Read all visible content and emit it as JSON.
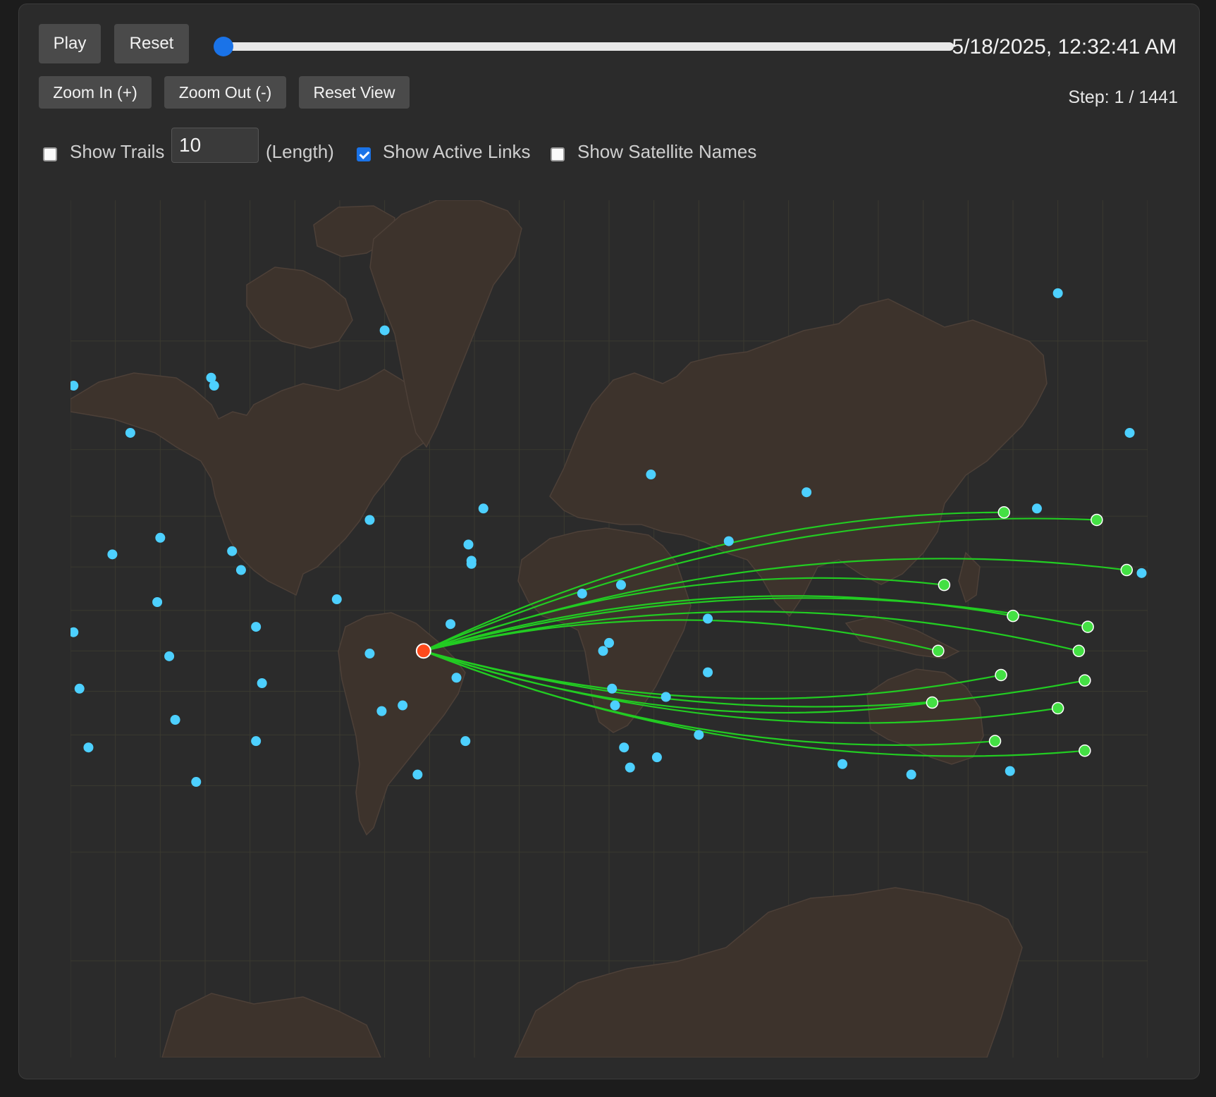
{
  "controls": {
    "play_label": "Play",
    "reset_label": "Reset",
    "zoom_in_label": "Zoom In (+)",
    "zoom_out_label": "Zoom Out (-)",
    "reset_view_label": "Reset View",
    "timeline_progress": 0,
    "datetime": "5/18/2025, 12:32:41 AM",
    "step_text": "Step: 1 / 1441"
  },
  "options": {
    "show_trails_label": "Show Trails",
    "show_trails_checked": false,
    "trail_length_value": "10",
    "trail_length_suffix": "(Length)",
    "show_active_links_label": "Show Active Links",
    "show_active_links_checked": true,
    "show_satellite_names_label": "Show Satellite Names",
    "show_satellite_names_checked": false
  },
  "colors": {
    "background": "#2b2b2b",
    "land": "#3d332c",
    "grid": "#3b3a30",
    "link": "#22cc22",
    "ground_station": "#ff4a1c",
    "linked_satellite": "#44e044",
    "satellite": "#4dd0ff",
    "slider_accent": "#1a73e8"
  },
  "map": {
    "lon_range": [
      -180,
      180
    ],
    "lat_range": [
      -82,
      84
    ],
    "ground_station": {
      "lon": -62.0,
      "lat": 0.0
    },
    "linked_satellites": [
      {
        "lon": 132.0,
        "lat": 46.0
      },
      {
        "lon": 112.0,
        "lat": 24.0
      },
      {
        "lon": 135.0,
        "lat": 13.0
      },
      {
        "lon": 163.0,
        "lat": 44.0
      },
      {
        "lon": 160.0,
        "lat": 9.0
      },
      {
        "lon": 110.0,
        "lat": 0.0
      },
      {
        "lon": 173.0,
        "lat": 29.0
      },
      {
        "lon": 157.0,
        "lat": 0.0
      },
      {
        "lon": 131.0,
        "lat": -9.0
      },
      {
        "lon": 108.0,
        "lat": -19.0
      },
      {
        "lon": 159.0,
        "lat": -11.0
      },
      {
        "lon": 150.0,
        "lat": -21.0
      },
      {
        "lon": 129.0,
        "lat": -32.0
      },
      {
        "lon": 159.0,
        "lat": -35.0
      }
    ],
    "satellites": [
      {
        "lon": -179,
        "lat": 70
      },
      {
        "lon": -160,
        "lat": 63
      },
      {
        "lon": -133,
        "lat": 71
      },
      {
        "lon": -132,
        "lat": 70
      },
      {
        "lon": -75,
        "lat": 76
      },
      {
        "lon": 150,
        "lat": 79
      },
      {
        "lon": 174,
        "lat": 63
      },
      {
        "lon": 14,
        "lat": 55
      },
      {
        "lon": 66,
        "lat": 51
      },
      {
        "lon": 143,
        "lat": 47
      },
      {
        "lon": -42,
        "lat": 47
      },
      {
        "lon": -80,
        "lat": 44
      },
      {
        "lon": -150,
        "lat": 39
      },
      {
        "lon": -166,
        "lat": 34
      },
      {
        "lon": -126,
        "lat": 35
      },
      {
        "lon": -123,
        "lat": 29
      },
      {
        "lon": -47,
        "lat": 37
      },
      {
        "lon": -46,
        "lat": 32
      },
      {
        "lon": -46,
        "lat": 31
      },
      {
        "lon": 178,
        "lat": 28
      },
      {
        "lon": 40,
        "lat": 38
      },
      {
        "lon": -9,
        "lat": 21
      },
      {
        "lon": 4,
        "lat": 24
      },
      {
        "lon": -91,
        "lat": 19
      },
      {
        "lon": -151,
        "lat": 18
      },
      {
        "lon": 33,
        "lat": 12
      },
      {
        "lon": -179,
        "lat": 7
      },
      {
        "lon": -118,
        "lat": 9
      },
      {
        "lon": -53,
        "lat": 10
      },
      {
        "lon": 0,
        "lat": 3
      },
      {
        "lon": -2,
        "lat": 0
      },
      {
        "lon": -80,
        "lat": -1
      },
      {
        "lon": -147,
        "lat": -2
      },
      {
        "lon": 33,
        "lat": -8
      },
      {
        "lon": -51,
        "lat": -10
      },
      {
        "lon": -116,
        "lat": -12
      },
      {
        "lon": -177,
        "lat": -14
      },
      {
        "lon": 1,
        "lat": -14
      },
      {
        "lon": 19,
        "lat": -17
      },
      {
        "lon": -69,
        "lat": -20
      },
      {
        "lon": 2,
        "lat": -20
      },
      {
        "lon": -76,
        "lat": -22
      },
      {
        "lon": -145,
        "lat": -25
      },
      {
        "lon": 30,
        "lat": -30
      },
      {
        "lon": -48,
        "lat": -32
      },
      {
        "lon": -118,
        "lat": -32
      },
      {
        "lon": -174,
        "lat": -34
      },
      {
        "lon": 5,
        "lat": -34
      },
      {
        "lon": 16,
        "lat": -37
      },
      {
        "lon": 7,
        "lat": -40
      },
      {
        "lon": 78,
        "lat": -39
      },
      {
        "lon": 101,
        "lat": -42
      },
      {
        "lon": 134,
        "lat": -41
      },
      {
        "lon": -64,
        "lat": -42
      },
      {
        "lon": -138,
        "lat": -44
      }
    ],
    "land_icons": [
      "north-america",
      "greenland",
      "south-america",
      "europe-asia",
      "africa",
      "australia",
      "antarctica"
    ]
  }
}
